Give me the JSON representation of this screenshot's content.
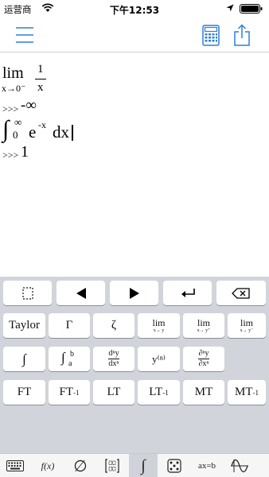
{
  "status": {
    "carrier": "运营商",
    "time": "下午12:53"
  },
  "math": {
    "lim_word": "lim",
    "lim_sub": "x→0⁻",
    "lim_num": "1",
    "lim_den": "x",
    "prompt1": ">>>",
    "result1": "-∞",
    "int_symbol": "∫",
    "int_upper": "∞",
    "int_lower": "0",
    "int_base": "e",
    "int_exp": "-x",
    "int_diff": "dx",
    "prompt2": ">>>",
    "result2": "1"
  },
  "keys": {
    "row2": {
      "taylor": "Taylor",
      "gamma": "Γ",
      "zeta": "ζ",
      "lim_label": "lim",
      "lim1_sub": "x→ y",
      "lim2_sub": "x→ y⁺",
      "lim3_sub": "x→ y⁻"
    },
    "row3": {
      "integral": "∫",
      "defint": "∫",
      "defint_b": "b",
      "defint_a": "a",
      "deriv_top": "dⁿy",
      "deriv_bot": "dxⁿ",
      "yn": "y⁽ⁿ⁾",
      "pderiv_top": "∂ⁿy",
      "pderiv_bot": "∂xⁿ"
    },
    "row4": {
      "ft": "FT",
      "ift": "FT",
      "ift_sup": "-1",
      "lt": "LT",
      "ilt": "LT",
      "ilt_sup": "-1",
      "mt": "MT",
      "imt": "MT",
      "imt_sup": "-1"
    }
  },
  "tabs": {
    "fx": "f(x)",
    "empty": "∅",
    "integral": "∫",
    "axb": "ax=b"
  },
  "colors": {
    "accent": "#2f7fd8",
    "keyboard_bg": "#d1d4da"
  }
}
